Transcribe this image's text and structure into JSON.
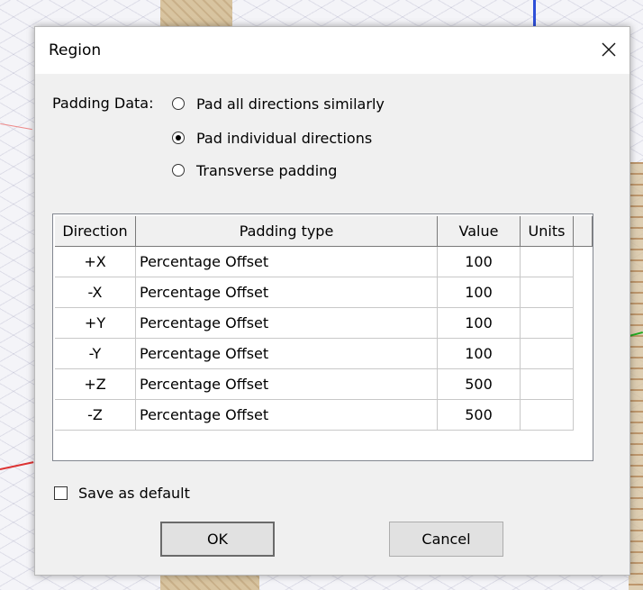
{
  "dialog": {
    "title": "Region",
    "close_icon": "close-icon"
  },
  "padding": {
    "label": "Padding Data:",
    "options": [
      {
        "label": "Pad all directions similarly",
        "checked": false
      },
      {
        "label": "Pad individual directions",
        "checked": true
      },
      {
        "label": "Transverse padding",
        "checked": false
      }
    ]
  },
  "table": {
    "headers": [
      "Direction",
      "Padding type",
      "Value",
      "Units"
    ],
    "rows": [
      {
        "direction": "+X",
        "type": "Percentage Offset",
        "value": "100",
        "units": ""
      },
      {
        "direction": "-X",
        "type": "Percentage Offset",
        "value": "100",
        "units": ""
      },
      {
        "direction": "+Y",
        "type": "Percentage Offset",
        "value": "100",
        "units": ""
      },
      {
        "direction": "-Y",
        "type": "Percentage Offset",
        "value": "100",
        "units": ""
      },
      {
        "direction": "+Z",
        "type": "Percentage Offset",
        "value": "500",
        "units": ""
      },
      {
        "direction": "-Z",
        "type": "Percentage Offset",
        "value": "500",
        "units": ""
      }
    ]
  },
  "save_default": {
    "label": "Save as default",
    "checked": false
  },
  "buttons": {
    "ok": "OK",
    "cancel": "Cancel"
  }
}
